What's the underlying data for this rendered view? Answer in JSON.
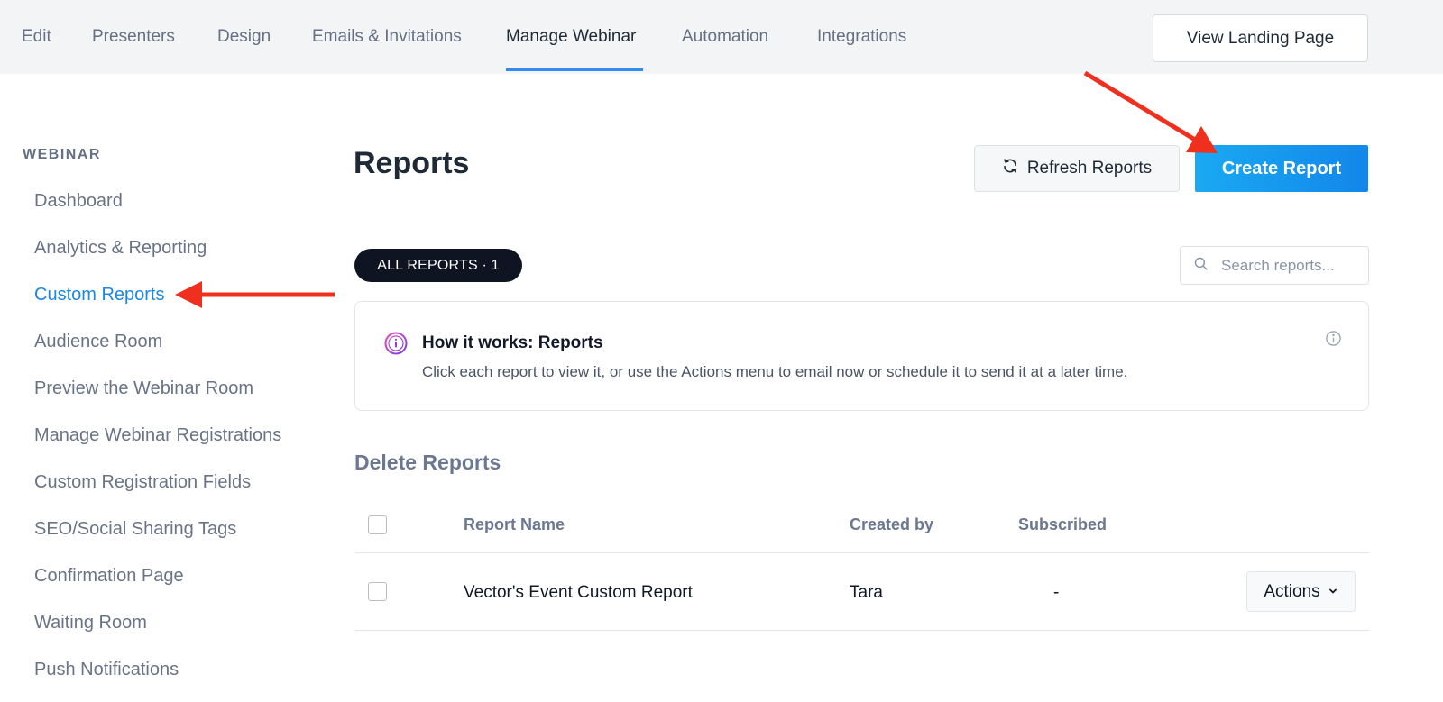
{
  "top_nav": {
    "tabs": [
      {
        "label": "Edit"
      },
      {
        "label": "Presenters"
      },
      {
        "label": "Design"
      },
      {
        "label": "Emails & Invitations"
      },
      {
        "label": "Manage Webinar",
        "active": true
      },
      {
        "label": "Automation"
      },
      {
        "label": "Integrations"
      }
    ],
    "view_landing_label": "View Landing Page"
  },
  "sidebar": {
    "heading": "WEBINAR",
    "items": [
      {
        "label": "Dashboard"
      },
      {
        "label": "Analytics & Reporting"
      },
      {
        "label": "Custom Reports",
        "active": true
      },
      {
        "label": "Audience Room"
      },
      {
        "label": "Preview the Webinar Room"
      },
      {
        "label": "Manage Webinar Registrations"
      },
      {
        "label": "Custom Registration Fields"
      },
      {
        "label": "SEO/Social Sharing Tags"
      },
      {
        "label": "Confirmation Page"
      },
      {
        "label": "Waiting Room"
      },
      {
        "label": "Push Notifications"
      }
    ]
  },
  "main": {
    "title": "Reports",
    "refresh_label": "Refresh Reports",
    "create_label": "Create Report",
    "filter_pill": "ALL REPORTS · 1",
    "search_placeholder": "Search reports...",
    "info": {
      "title": "How it works: Reports",
      "body": "Click each report to view it, or use the Actions menu to email now or schedule it to send it at a later time."
    },
    "delete_label": "Delete Reports",
    "table": {
      "headers": [
        "Report Name",
        "Created by",
        "Subscribed"
      ],
      "rows": [
        {
          "name": "Vector's Event Custom Report",
          "created_by": "Tara",
          "subscribed": "-",
          "actions_label": "Actions"
        }
      ]
    }
  },
  "colors": {
    "accent": "#1b87e6",
    "primary_button": "#1287ea",
    "annotation_arrow": "#f0301e",
    "pill_bg": "#0e1422"
  },
  "icons": [
    "refresh-icon",
    "search-icon",
    "info-circle-icon",
    "chevron-down-icon"
  ]
}
